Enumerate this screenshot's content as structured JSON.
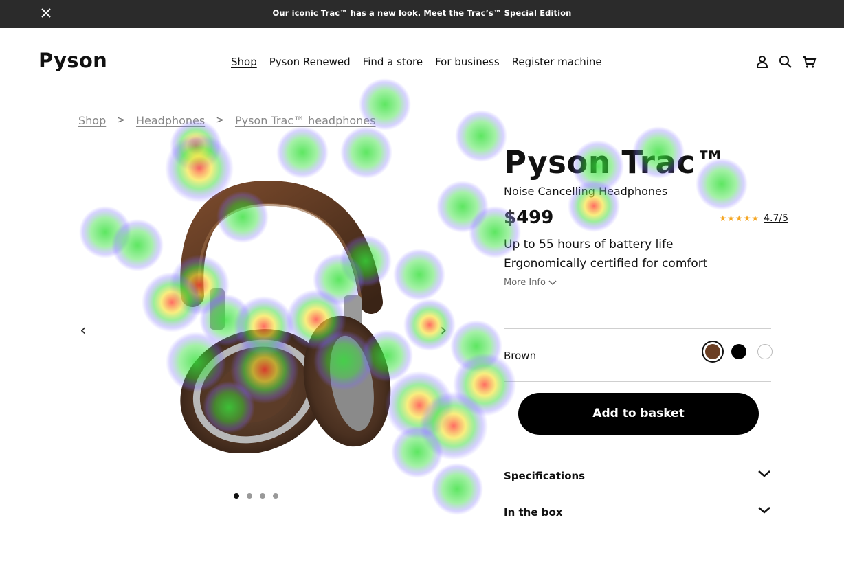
{
  "announcement": {
    "message": "Our iconic Trac™ has a new look. Meet the Trac’s™ Special Edition"
  },
  "header": {
    "logo": "Pyson",
    "nav": [
      "Shop",
      "Pyson Renewed",
      "Find a store",
      "For business",
      "Register machine"
    ],
    "icons": [
      "account-icon",
      "search-icon",
      "cart-icon"
    ]
  },
  "breadcrumb": [
    "Shop",
    "Headphones",
    "Pyson Trac™ headphones"
  ],
  "gallery": {
    "dots_total": 4,
    "active_dot": 1,
    "icons": [
      "chevron-left-icon",
      "chevron-right-icon"
    ]
  },
  "product": {
    "title": "Pyson Trac™",
    "subtitle": "Noise Cancelling Headphones",
    "currency": "$",
    "price": "499",
    "rating": "4.7/5",
    "features": [
      "Up to 55 hours of battery life",
      "Ergonomically certified for comfort"
    ],
    "more_info": "More Info",
    "color_label": "Brown",
    "colors": [
      "#6b3f24",
      "#000000",
      "#ffffff"
    ],
    "add_to_basket": "Add to basket",
    "accordion": [
      "Specifications",
      "In the box"
    ]
  },
  "colors": {
    "topbar": "#2b2b2b",
    "button": "#000000",
    "star": "#f5a623"
  }
}
